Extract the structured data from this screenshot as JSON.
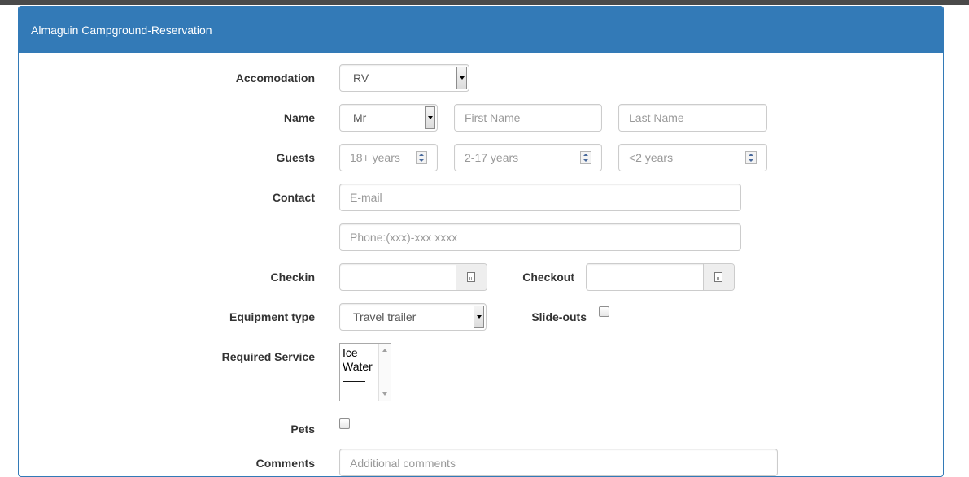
{
  "panel": {
    "title": "Almaguin Campground-Reservation"
  },
  "fields": {
    "accommodation": {
      "label": "Accomodation",
      "value": "RV"
    },
    "name": {
      "label": "Name",
      "title_value": "Mr",
      "first_placeholder": "First Name",
      "last_placeholder": "Last Name"
    },
    "guests": {
      "label": "Guests",
      "adults_placeholder": "18+ years",
      "children_placeholder": "2-17 years",
      "infants_placeholder": "<2 years"
    },
    "contact": {
      "label": "Contact",
      "email_placeholder": "E-mail",
      "phone_placeholder": "Phone:(xxx)-xxx xxxx"
    },
    "checkin": {
      "label": "Checkin",
      "value": ""
    },
    "checkout": {
      "label": "Checkout",
      "value": ""
    },
    "equipment": {
      "label": "Equipment type",
      "value": "Travel trailer"
    },
    "slideouts": {
      "label": "Slide-outs",
      "checked": false
    },
    "service": {
      "label": "Required Service",
      "options": [
        "Ice",
        "Water",
        "——"
      ]
    },
    "pets": {
      "label": "Pets",
      "checked": false
    },
    "comments": {
      "label": "Comments",
      "placeholder": "Additional comments"
    }
  },
  "icons": {
    "calendar": "calendar-icon",
    "select_arrow": "chevron-down-icon",
    "spinner": "spinner-icon"
  },
  "colors": {
    "header_bg": "#337ab7",
    "header_text": "#ffffff",
    "topbar": "#4a4a4a"
  }
}
